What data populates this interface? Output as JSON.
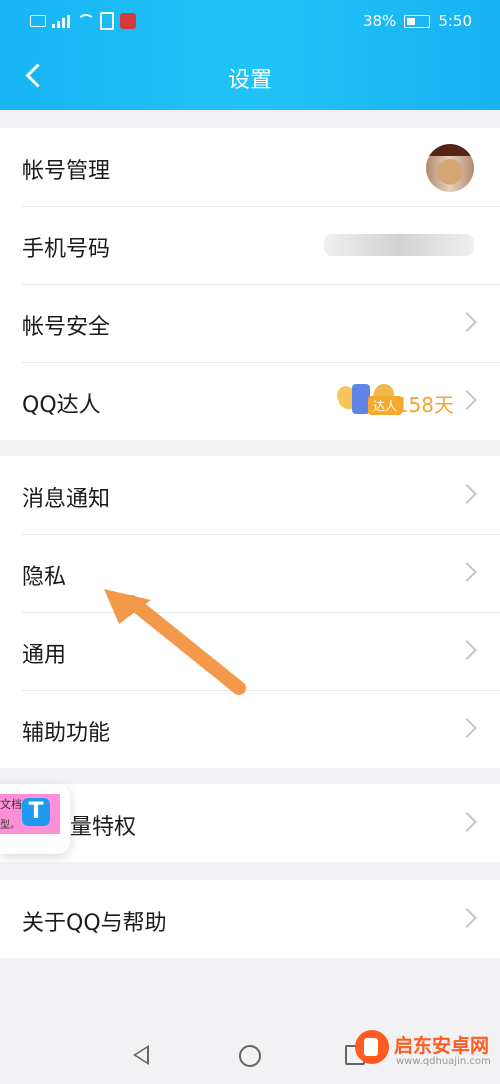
{
  "status_bar": {
    "left_icons": [
      "HD-icon",
      "4G-signal-icon",
      "wifi-icon",
      "vibrate-icon",
      "app-badge-icon"
    ],
    "battery_percent": "38%",
    "time": "5:50",
    "network": "4G"
  },
  "header": {
    "title": "设置"
  },
  "groups": [
    {
      "items": [
        {
          "label": "帐号管理",
          "name": "row-account-management"
        },
        {
          "label": "手机号码",
          "name": "row-phone-number"
        },
        {
          "label": "帐号安全",
          "name": "row-account-security"
        },
        {
          "label": "QQ达人",
          "name": "row-qq-talent",
          "badge_text": "达人",
          "days": "158天"
        }
      ]
    },
    {
      "items": [
        {
          "label": "消息通知",
          "name": "row-message-notification"
        },
        {
          "label": "隐私",
          "name": "row-privacy"
        },
        {
          "label": "通用",
          "name": "row-general"
        },
        {
          "label": "辅助功能",
          "name": "row-accessibility"
        }
      ]
    },
    {
      "items": [
        {
          "label": "量特权",
          "name": "row-privileges"
        }
      ]
    },
    {
      "items": [
        {
          "label": "关于QQ与帮助",
          "name": "row-about-help"
        }
      ]
    }
  ],
  "floating_card": {
    "text_top": "文档",
    "text_bottom": "型。"
  },
  "watermark": {
    "title": "启东安卓网",
    "url": "www.qdhuajin.com"
  },
  "colors": {
    "accent": "#1eb8f5",
    "arrow": "#f39a4a",
    "talent_days": "#f3a62a"
  }
}
